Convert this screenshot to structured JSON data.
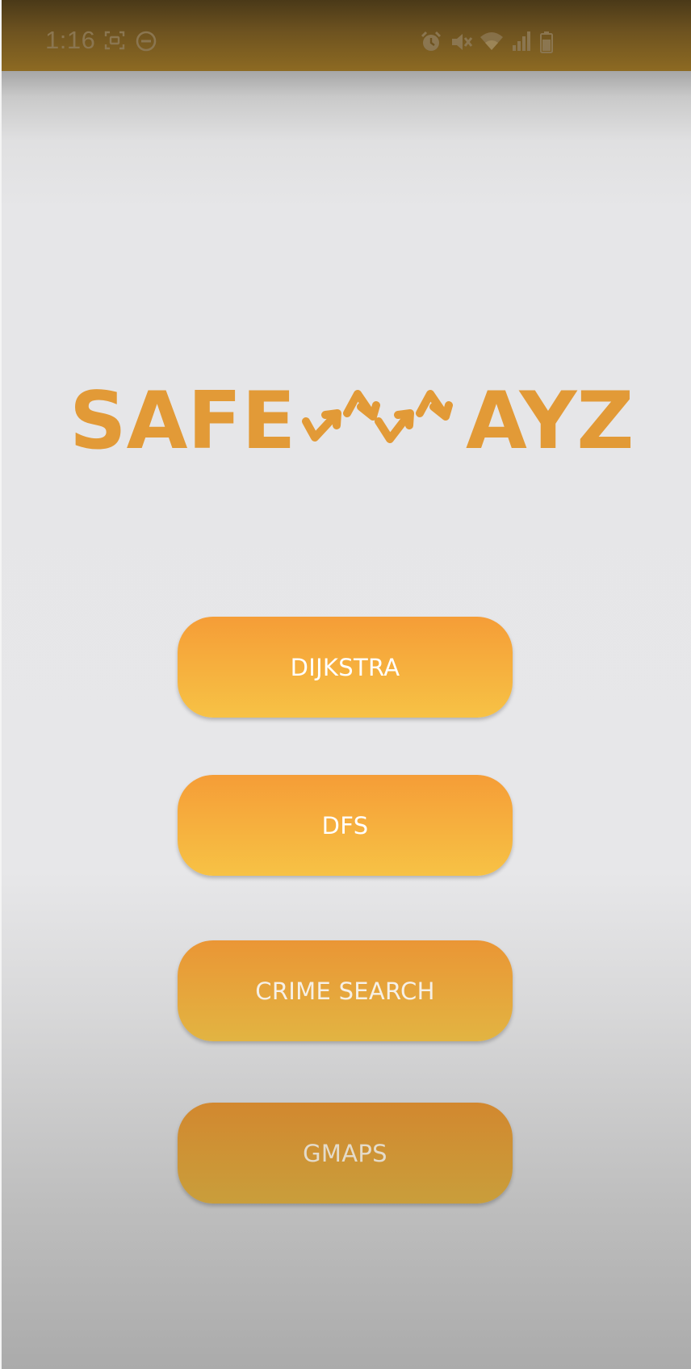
{
  "status_bar": {
    "time": "1:16",
    "left_icons": [
      "screenshot-icon",
      "do-not-disturb-icon"
    ],
    "right_icons": [
      "alarm-icon",
      "vibrate-mute-icon",
      "wifi-icon",
      "signal-icon",
      "battery-icon"
    ]
  },
  "logo": {
    "text": "SAFE WAYZ",
    "color": "#e29a37"
  },
  "buttons": {
    "dijkstra": "DIJKSTRA",
    "dfs": "DFS",
    "crime_search": "CRIME SEARCH",
    "gmaps": "GMAPS"
  },
  "colors": {
    "accent_top": "#f59d37",
    "accent_bottom": "#f7c245",
    "status_bar": "#6e5320"
  }
}
